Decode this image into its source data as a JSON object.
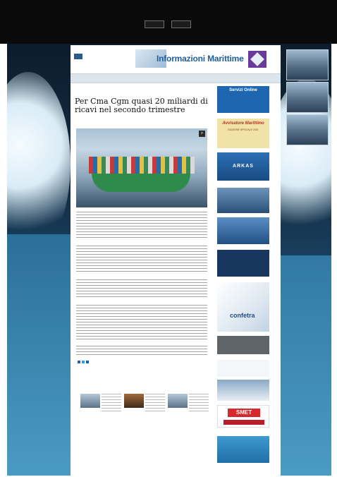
{
  "site": {
    "title": "Informazioni Marittime",
    "publisher_caption": "",
    "nav": [
      "",
      "",
      "",
      "",
      "",
      "",
      "",
      ""
    ]
  },
  "cookie_banner": {
    "text": "",
    "buttons": [
      "",
      ""
    ],
    "more_link": ""
  },
  "article": {
    "breadcrumb": "",
    "date": "",
    "title": "Per Cma Cgm quasi 20 miliardi di ricavi nel secondo trimestre",
    "subtitle": "",
    "share_label": "",
    "tags": ""
  },
  "related": {
    "title": ""
  },
  "sidebar": {
    "servizi_kicker": "",
    "servizi_title": "Servizi Online",
    "servizi_tagline": "",
    "bollettino_kicker": "",
    "bollettino_title": "Avvisatore Marittimo",
    "bollettino_edition": "EDIZIONE SPECIALE 2021",
    "arkas": "ARKAS",
    "terminal_text": "",
    "confetra": "confetra",
    "grey_banner": "",
    "smet": "SMET"
  },
  "colors": {
    "brand_blue": "#1f5f9c",
    "link_blue": "#3a7ab5",
    "cookie_bg": "#0a0a0a",
    "smet_red": "#d6282d"
  },
  "icons": {
    "zoom": "magnifier-icon",
    "share": "social-share-icon"
  }
}
